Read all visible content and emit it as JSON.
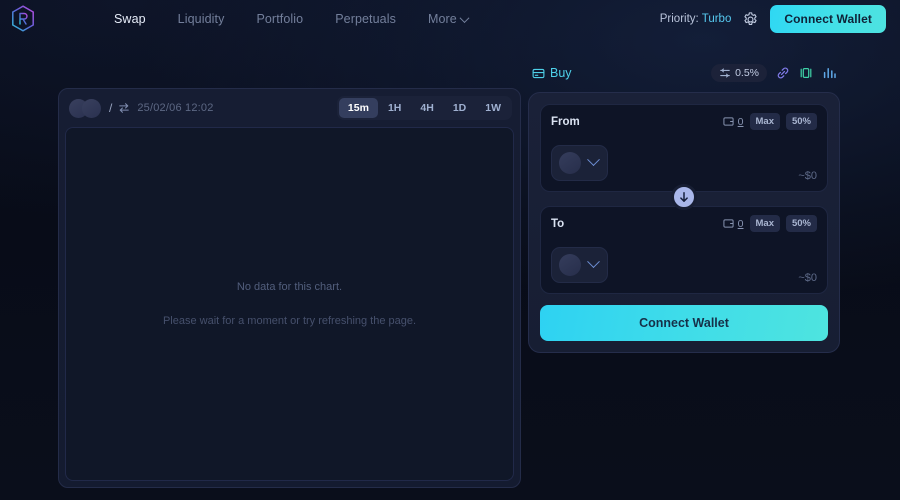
{
  "header": {
    "logo_icon": "hexagon-r-logo-icon",
    "nav": [
      {
        "label": "Swap",
        "active": true
      },
      {
        "label": "Liquidity",
        "active": false
      },
      {
        "label": "Portfolio",
        "active": false
      },
      {
        "label": "Perpetuals",
        "active": false
      },
      {
        "label": "More",
        "active": false,
        "has_chevron": true
      }
    ],
    "priority_label": "Priority:",
    "priority_value": "Turbo",
    "settings_icon": "gear-icon",
    "connect_wallet": "Connect Wallet"
  },
  "chart": {
    "pair_separator": "/",
    "swap_pair_icon": "swap-arrows-icon",
    "timestamp": "25/02/06 12:02",
    "timeframes": [
      {
        "label": "15m",
        "active": true
      },
      {
        "label": "1H",
        "active": false
      },
      {
        "label": "4H",
        "active": false
      },
      {
        "label": "1D",
        "active": false
      },
      {
        "label": "1W",
        "active": false
      }
    ],
    "empty_title": "No data for this chart.",
    "empty_subtitle": "Please wait for a moment or try refreshing the page."
  },
  "swap": {
    "tab_label": "Buy",
    "tab_icon": "card-icon",
    "slippage_icon": "sliders-icon",
    "slippage_value": "0.5%",
    "link_icon": "link-icon",
    "route_icon": "route-icon",
    "chart_icon": "bar-chart-icon",
    "from": {
      "label": "From",
      "wallet_icon": "wallet-icon",
      "balance": "0",
      "max_label": "Max",
      "half_label": "50%",
      "token_placeholder_icon": "token-placeholder-icon",
      "chevron_icon": "chevron-down-icon",
      "usd_value": "~$0"
    },
    "to": {
      "label": "To",
      "wallet_icon": "wallet-icon",
      "balance": "0",
      "max_label": "Max",
      "half_label": "50%",
      "token_placeholder_icon": "token-placeholder-icon",
      "chevron_icon": "chevron-down-icon",
      "usd_value": "~$0"
    },
    "flip_icon": "arrow-down-icon",
    "connect_wallet": "Connect Wallet"
  },
  "colors": {
    "background": "#080c18",
    "panel": "#171e33",
    "accent_cyan": "#3fdce9",
    "accent_blue": "#56c8ef",
    "flip_button": "#a9b7ea"
  }
}
